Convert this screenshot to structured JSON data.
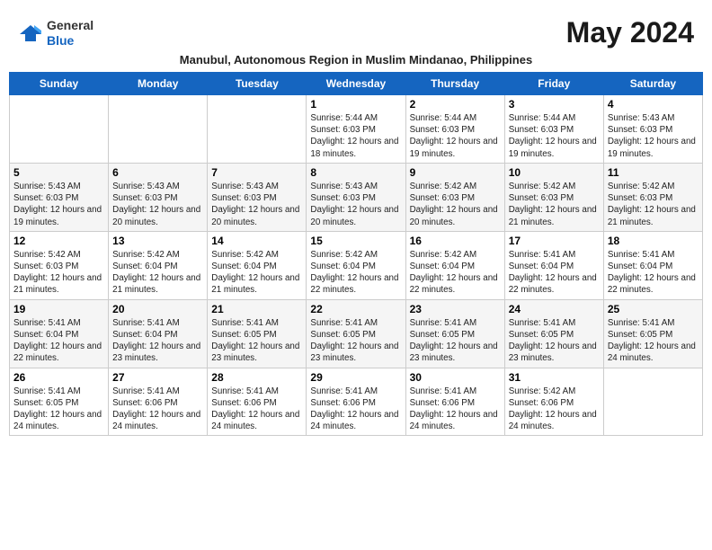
{
  "header": {
    "logo_line1": "General",
    "logo_line2": "Blue",
    "month_title": "May 2024",
    "subtitle": "Manubul, Autonomous Region in Muslim Mindanao, Philippines"
  },
  "days_of_week": [
    "Sunday",
    "Monday",
    "Tuesday",
    "Wednesday",
    "Thursday",
    "Friday",
    "Saturday"
  ],
  "weeks": [
    [
      {
        "day": "",
        "info": ""
      },
      {
        "day": "",
        "info": ""
      },
      {
        "day": "",
        "info": ""
      },
      {
        "day": "1",
        "info": "Sunrise: 5:44 AM\nSunset: 6:03 PM\nDaylight: 12 hours and 18 minutes."
      },
      {
        "day": "2",
        "info": "Sunrise: 5:44 AM\nSunset: 6:03 PM\nDaylight: 12 hours and 19 minutes."
      },
      {
        "day": "3",
        "info": "Sunrise: 5:44 AM\nSunset: 6:03 PM\nDaylight: 12 hours and 19 minutes."
      },
      {
        "day": "4",
        "info": "Sunrise: 5:43 AM\nSunset: 6:03 PM\nDaylight: 12 hours and 19 minutes."
      }
    ],
    [
      {
        "day": "5",
        "info": "Sunrise: 5:43 AM\nSunset: 6:03 PM\nDaylight: 12 hours and 19 minutes."
      },
      {
        "day": "6",
        "info": "Sunrise: 5:43 AM\nSunset: 6:03 PM\nDaylight: 12 hours and 20 minutes."
      },
      {
        "day": "7",
        "info": "Sunrise: 5:43 AM\nSunset: 6:03 PM\nDaylight: 12 hours and 20 minutes."
      },
      {
        "day": "8",
        "info": "Sunrise: 5:43 AM\nSunset: 6:03 PM\nDaylight: 12 hours and 20 minutes."
      },
      {
        "day": "9",
        "info": "Sunrise: 5:42 AM\nSunset: 6:03 PM\nDaylight: 12 hours and 20 minutes."
      },
      {
        "day": "10",
        "info": "Sunrise: 5:42 AM\nSunset: 6:03 PM\nDaylight: 12 hours and 21 minutes."
      },
      {
        "day": "11",
        "info": "Sunrise: 5:42 AM\nSunset: 6:03 PM\nDaylight: 12 hours and 21 minutes."
      }
    ],
    [
      {
        "day": "12",
        "info": "Sunrise: 5:42 AM\nSunset: 6:03 PM\nDaylight: 12 hours and 21 minutes."
      },
      {
        "day": "13",
        "info": "Sunrise: 5:42 AM\nSunset: 6:04 PM\nDaylight: 12 hours and 21 minutes."
      },
      {
        "day": "14",
        "info": "Sunrise: 5:42 AM\nSunset: 6:04 PM\nDaylight: 12 hours and 21 minutes."
      },
      {
        "day": "15",
        "info": "Sunrise: 5:42 AM\nSunset: 6:04 PM\nDaylight: 12 hours and 22 minutes."
      },
      {
        "day": "16",
        "info": "Sunrise: 5:42 AM\nSunset: 6:04 PM\nDaylight: 12 hours and 22 minutes."
      },
      {
        "day": "17",
        "info": "Sunrise: 5:41 AM\nSunset: 6:04 PM\nDaylight: 12 hours and 22 minutes."
      },
      {
        "day": "18",
        "info": "Sunrise: 5:41 AM\nSunset: 6:04 PM\nDaylight: 12 hours and 22 minutes."
      }
    ],
    [
      {
        "day": "19",
        "info": "Sunrise: 5:41 AM\nSunset: 6:04 PM\nDaylight: 12 hours and 22 minutes."
      },
      {
        "day": "20",
        "info": "Sunrise: 5:41 AM\nSunset: 6:04 PM\nDaylight: 12 hours and 23 minutes."
      },
      {
        "day": "21",
        "info": "Sunrise: 5:41 AM\nSunset: 6:05 PM\nDaylight: 12 hours and 23 minutes."
      },
      {
        "day": "22",
        "info": "Sunrise: 5:41 AM\nSunset: 6:05 PM\nDaylight: 12 hours and 23 minutes."
      },
      {
        "day": "23",
        "info": "Sunrise: 5:41 AM\nSunset: 6:05 PM\nDaylight: 12 hours and 23 minutes."
      },
      {
        "day": "24",
        "info": "Sunrise: 5:41 AM\nSunset: 6:05 PM\nDaylight: 12 hours and 23 minutes."
      },
      {
        "day": "25",
        "info": "Sunrise: 5:41 AM\nSunset: 6:05 PM\nDaylight: 12 hours and 24 minutes."
      }
    ],
    [
      {
        "day": "26",
        "info": "Sunrise: 5:41 AM\nSunset: 6:05 PM\nDaylight: 12 hours and 24 minutes."
      },
      {
        "day": "27",
        "info": "Sunrise: 5:41 AM\nSunset: 6:06 PM\nDaylight: 12 hours and 24 minutes."
      },
      {
        "day": "28",
        "info": "Sunrise: 5:41 AM\nSunset: 6:06 PM\nDaylight: 12 hours and 24 minutes."
      },
      {
        "day": "29",
        "info": "Sunrise: 5:41 AM\nSunset: 6:06 PM\nDaylight: 12 hours and 24 minutes."
      },
      {
        "day": "30",
        "info": "Sunrise: 5:41 AM\nSunset: 6:06 PM\nDaylight: 12 hours and 24 minutes."
      },
      {
        "day": "31",
        "info": "Sunrise: 5:42 AM\nSunset: 6:06 PM\nDaylight: 12 hours and 24 minutes."
      },
      {
        "day": "",
        "info": ""
      }
    ]
  ]
}
